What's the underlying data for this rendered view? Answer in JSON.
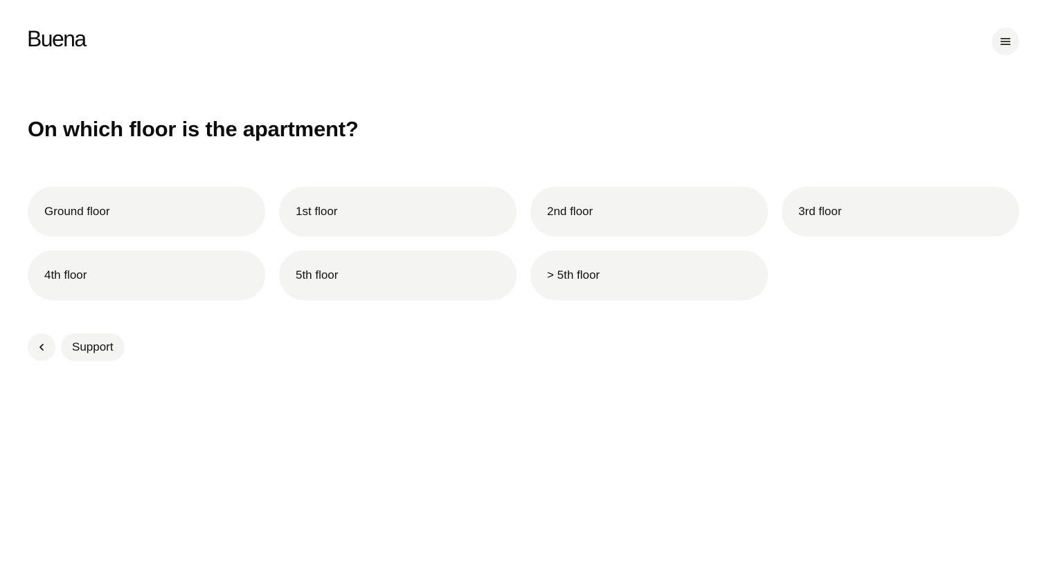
{
  "header": {
    "logo_text": "Buena",
    "menu_icon": "hamburger-menu-icon"
  },
  "question": {
    "title": "On which floor is the apartment?"
  },
  "options": [
    {
      "label": "Ground floor"
    },
    {
      "label": "1st floor"
    },
    {
      "label": "2nd floor"
    },
    {
      "label": "3rd floor"
    },
    {
      "label": "4th floor"
    },
    {
      "label": "5th floor"
    },
    {
      "label": "> 5th floor"
    }
  ],
  "navigation": {
    "back_icon": "chevron-left-icon",
    "support_label": "Support"
  },
  "colors": {
    "background": "#ffffff",
    "option_background": "#f4f4f2",
    "text": "#111111"
  }
}
